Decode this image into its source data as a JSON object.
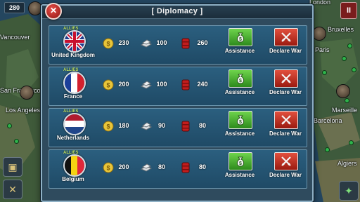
{
  "hud": {
    "score_badge": "280"
  },
  "map_labels": [
    "London",
    "Bruxelles",
    "Paris",
    "Vancouver",
    "San Francisco",
    "Los Angeles",
    "Marseille",
    "Barcelona",
    "Algiers"
  ],
  "side_buttons": {
    "top_right": "II"
  },
  "dialog": {
    "title": "[ Diplomacy ]",
    "close_label": "✕",
    "rows": [
      {
        "alliance": "ALLIES",
        "country": "United Kingdom",
        "flag": "united-kingdom-flag",
        "gold": "230",
        "steel": "100",
        "oil": "260",
        "assistance_label": "Assistance",
        "declare_war_label": "Declare War"
      },
      {
        "alliance": "ALLIES",
        "country": "France",
        "flag": "france-flag",
        "gold": "200",
        "steel": "100",
        "oil": "240",
        "assistance_label": "Assistance",
        "declare_war_label": "Declare War"
      },
      {
        "alliance": "ALLIES",
        "country": "Netherlands",
        "flag": "netherlands-flag",
        "gold": "180",
        "steel": "90",
        "oil": "80",
        "assistance_label": "Assistance",
        "declare_war_label": "Declare War"
      },
      {
        "alliance": "ALLIES",
        "country": "Belgium",
        "flag": "belgium-flag",
        "gold": "200",
        "steel": "80",
        "oil": "80",
        "assistance_label": "Assistance",
        "declare_war_label": "Declare War"
      }
    ]
  },
  "colors": {
    "allies": "#c3e86b",
    "assist_button": "#4cb83a",
    "declare_war_button": "#c23324",
    "row_background": "#245472"
  }
}
